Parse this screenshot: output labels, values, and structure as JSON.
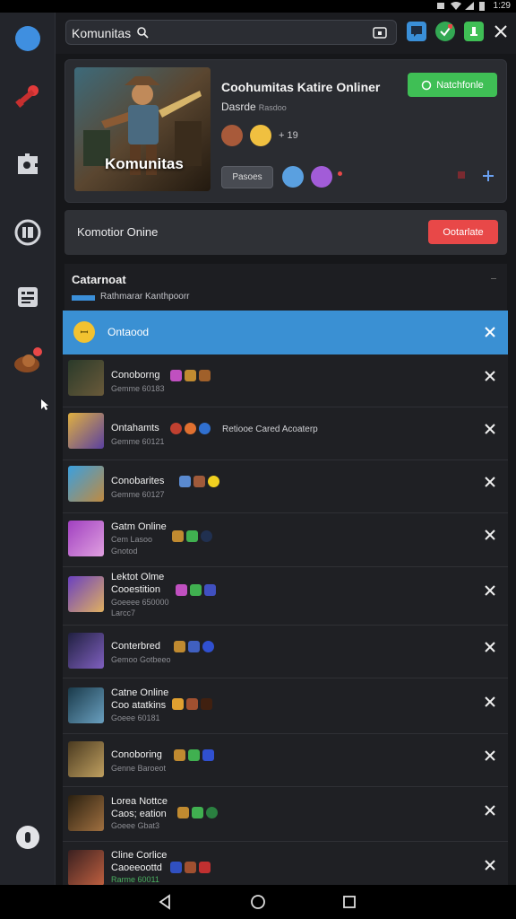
{
  "status": {
    "time": "1:29"
  },
  "sidebar": {
    "items": [
      {
        "icon": "compass-icon"
      },
      {
        "icon": "key-icon"
      },
      {
        "icon": "puzzle-icon"
      },
      {
        "icon": "library-icon"
      },
      {
        "icon": "list-icon"
      },
      {
        "icon": "avatar-icon"
      },
      {
        "icon": "settings-icon"
      }
    ]
  },
  "search": {
    "value": "Komunitas"
  },
  "hero": {
    "image_label": "Komunitas",
    "title": "Coohumitas Katire Onliner",
    "subtitle": "Dasrde",
    "subtitle_extra": "Rasdoo",
    "follow_label": "Natchfonle",
    "count": "+ 19",
    "pill_label": "Pasoes"
  },
  "band": {
    "title": "Komotior Onine",
    "button": "Ootarlate"
  },
  "section": {
    "title": "Catarnoat",
    "subtitle": "Rathmarar Kanthpoorr"
  },
  "highlight": {
    "label": "Ontaood",
    "badge": "ꟷ"
  },
  "rows": [
    {
      "title": "Conoborng",
      "meta": "Gemme 60183",
      "extra": ""
    },
    {
      "title": "Ontahamts",
      "meta": "Gemme 60121",
      "extra": "Retiooe Cared Acoaterp"
    },
    {
      "title": "Conobarites",
      "meta": "Gemme 60127",
      "extra": ""
    },
    {
      "title": "Gatm Online",
      "meta": "Cem Lasoo",
      "meta2": "Gnotod",
      "extra": ""
    },
    {
      "title": "Lektot Olme",
      "title2": "Cooestition",
      "meta": "Goeeee 650000",
      "meta2": "Larcc7",
      "extra": ""
    },
    {
      "title": "Conterbred",
      "meta": "Gemoo Gotbeeo",
      "extra": ""
    },
    {
      "title": "Catne Online",
      "title2": "Coo atatkins",
      "meta": "Goeee 60181",
      "extra": ""
    },
    {
      "title": "Conoboring",
      "meta": "Genne Baroeot",
      "extra": ""
    },
    {
      "title": "Lorea Nottce",
      "title2": "Caos; eation",
      "meta": "Goeee Gbat3",
      "extra": ""
    },
    {
      "title": "Cline Corlice",
      "title2": "Caoeeoottd",
      "meta": "Rarme 60011",
      "extra": ""
    }
  ],
  "colors": {
    "accent_blue": "#3a90d3",
    "follow_green": "#3fbf55",
    "danger_red": "#e84848"
  }
}
